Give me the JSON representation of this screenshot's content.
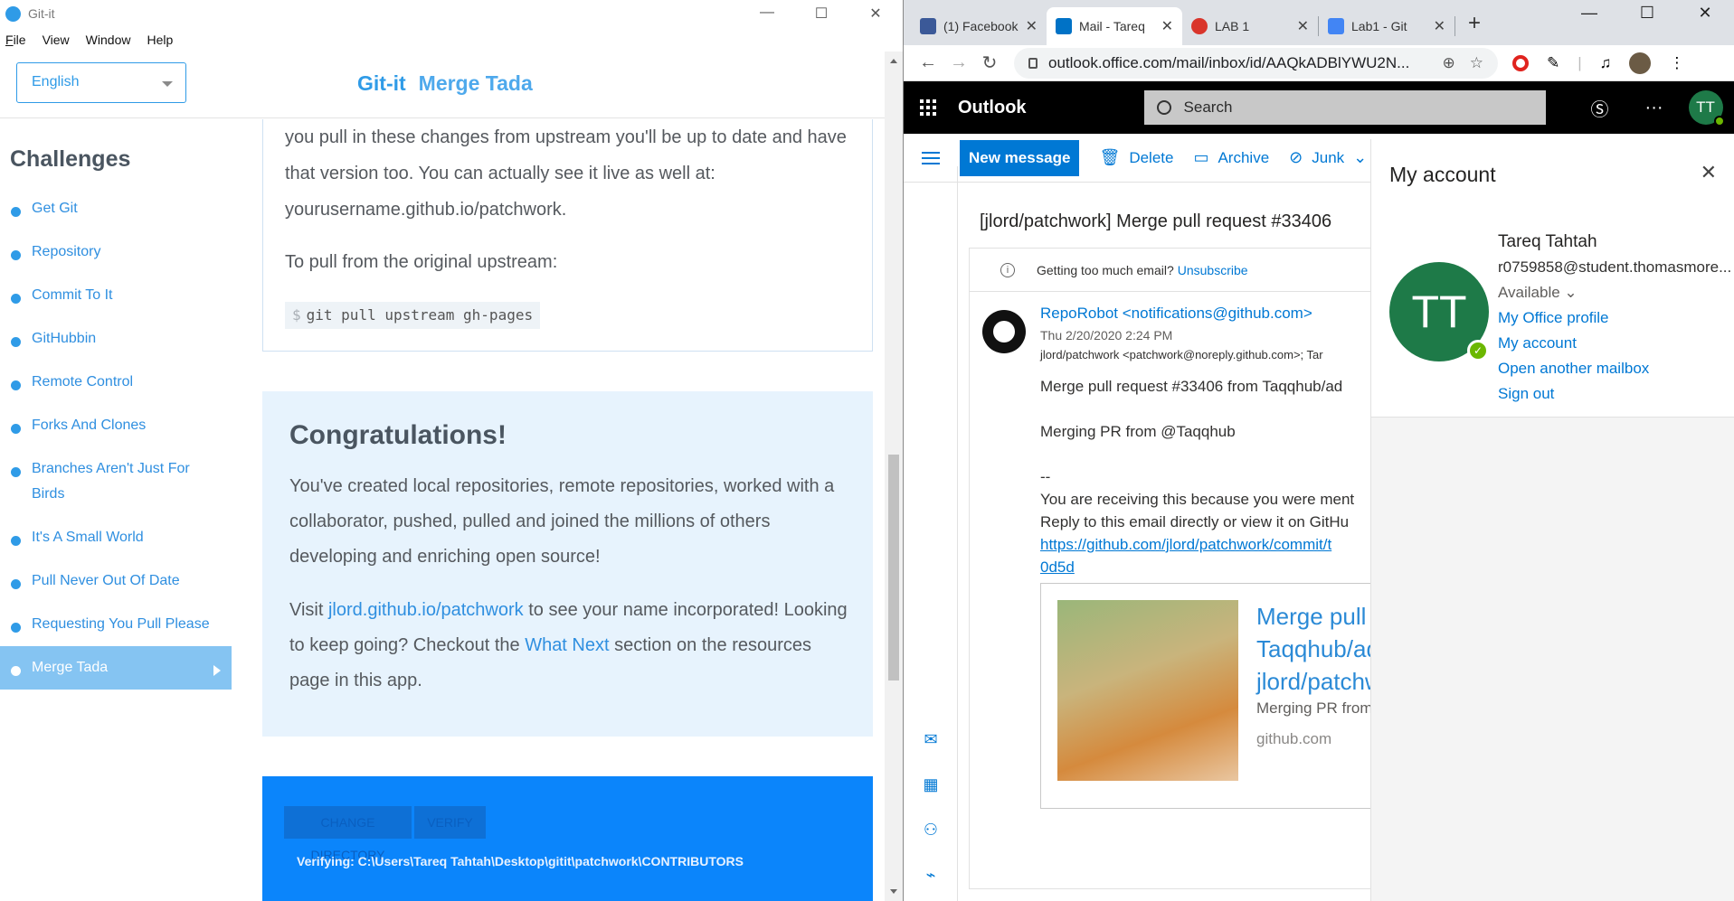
{
  "gitit": {
    "window_title": "Git-it",
    "window_controls": [
      "—",
      "☐",
      "✕"
    ],
    "menu": [
      "File",
      "View",
      "Window",
      "Help"
    ],
    "language": "English",
    "brand": "Git-it",
    "chapter": "Merge Tada",
    "sidebar_title": "Challenges",
    "challenges": [
      {
        "label": "Get Git"
      },
      {
        "label": "Repository"
      },
      {
        "label": "Commit To It"
      },
      {
        "label": "GitHubbin"
      },
      {
        "label": "Remote Control"
      },
      {
        "label": "Forks And Clones"
      },
      {
        "label": "Branches Aren't Just For Birds"
      },
      {
        "label": "It's A Small World"
      },
      {
        "label": "Pull Never Out Of Date"
      },
      {
        "label": "Requesting You Pull Please"
      },
      {
        "label": "Merge Tada"
      }
    ],
    "card": {
      "para1": "you pull in these changes from upstream you'll be up to date and have that version too. You can actually see it live as well at: yourusername.github.io/patchwork.",
      "para2": "To pull from the original upstream:",
      "code_prompt": "$",
      "code": "git pull upstream gh-pages"
    },
    "congrats": {
      "title": "Congratulations!",
      "para1": "You've created local repositories, remote repositories, worked with a collaborator, pushed, pulled and joined the millions of others developing and enriching open source!",
      "visit_prefix": "Visit ",
      "visit_link": "jlord.github.io/patchwork",
      "visit_suffix": " to see your name incorporated! Looking to keep going? Checkout the ",
      "whatnext_link": "What Next",
      "visit_end": " section on the resources page in this app."
    },
    "verify": {
      "change_dir": "CHANGE DIRECTORY",
      "verify": "VERIFY",
      "status": "Verifying: C:\\Users\\Tareq Tahtah\\Desktop\\gitit\\patchwork\\CONTRIBUTORS"
    }
  },
  "browser": {
    "tabs": [
      {
        "label": "(1) Facebook",
        "fav": "#3b5998",
        "active": false
      },
      {
        "label": "Mail - Tareq",
        "fav": "#0072c6",
        "active": true
      },
      {
        "label": "LAB 1",
        "fav": "#d9352b",
        "active": false
      },
      {
        "label": "Lab1 - Git",
        "fav": "#4285f4",
        "active": false
      }
    ],
    "newtab": "+",
    "window_controls": [
      "—",
      "☐",
      "✕"
    ],
    "url": "outlook.office.com/mail/inbox/id/AAQkADBlYWU2N..."
  },
  "outlook": {
    "app_name": "Outlook",
    "search_placeholder": "Search",
    "avatar_initials": "TT",
    "commands": {
      "new_message": "New message",
      "delete": "Delete",
      "archive": "Archive",
      "junk": "Junk"
    },
    "message": {
      "subject": "[jlord/patchwork] Merge pull request #33406",
      "unsub_text": "Getting too much email?",
      "unsub_link": "Unsubscribe",
      "sender": "RepoRobot <notifications@github.com>",
      "date": "Thu 2/20/2020 2:24 PM",
      "to": "jlord/patchwork <patchwork@noreply.github.com>; Tar",
      "body": {
        "line1": "Merge pull request #33406 from Taqqhub/ad",
        "line2": "Merging PR from @Taqqhub",
        "line3": "--",
        "line4": "You are receiving this because you were ment",
        "line5": "Reply to this email directly or view it on GitHu",
        "link1": "https://github.com/jlord/patchwork/commit/t",
        "link2": "0d5d"
      },
      "preview": {
        "title1": "Merge pull",
        "title2": "Taqqhub/ad",
        "title3": "jlord/patchw",
        "desc": "Merging PR from",
        "site": "github.com"
      }
    },
    "account": {
      "title": "My account",
      "initials": "TT",
      "name": "Tareq Tahtah",
      "email": "r0759858@student.thomasmore...",
      "status": "Available",
      "links": [
        "My Office profile",
        "My account",
        "Open another mailbox",
        "Sign out"
      ]
    }
  }
}
